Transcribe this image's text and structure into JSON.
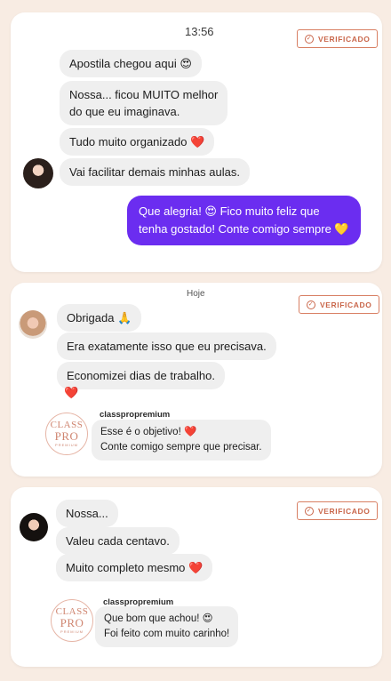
{
  "colors": {
    "accent": "#6b2df0",
    "badge": "#c9664a",
    "background": "#f8ece3"
  },
  "verified_label": "VERIFICADO",
  "conversation1": {
    "timestamp": "13:56",
    "incoming": [
      "Apostila chegou aqui 😍",
      "Nossa... ficou MUITO melhor",
      "do que eu imaginava.",
      "Tudo muito organizado ❤️",
      "Vai facilitar demais minhas aulas."
    ],
    "outgoing": [
      "Que alegria! 😍 Fico muito feliz que",
      "tenha gostado! Conte comigo sempre 💛"
    ]
  },
  "conversation2": {
    "day_label": "Hoje",
    "incoming": [
      "Obrigada 🙏",
      "Era exatamente isso que eu precisava.",
      "Economizei dias de trabalho.",
      "❤️"
    ],
    "reply": {
      "brand": "classpropremium",
      "lines": [
        "Esse é o objetivo! ❤️",
        "Conte comigo sempre que precisar."
      ]
    }
  },
  "conversation3": {
    "incoming": [
      "Nossa...",
      "Valeu cada centavo.",
      "Muito completo mesmo ❤️"
    ],
    "reply": {
      "brand": "classpropremium",
      "lines": [
        "Que bom que achou! 😍",
        "Foi feito com muito carinho!"
      ]
    }
  },
  "logo": {
    "line1": "CLASS",
    "line2": "PRO",
    "line3": "PREMIUM"
  }
}
